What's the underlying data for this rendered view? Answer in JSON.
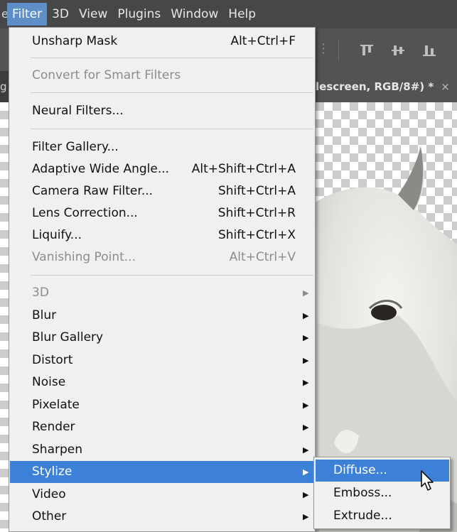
{
  "menubar": {
    "left_fragment": "e",
    "items": [
      {
        "label": "Filter",
        "active": true
      },
      {
        "label": "3D"
      },
      {
        "label": "View"
      },
      {
        "label": "Plugins"
      },
      {
        "label": "Window"
      },
      {
        "label": "Help"
      }
    ]
  },
  "tabbar": {
    "left_fragment": "g",
    "document_tab": "lescreen, RGB/8#) *",
    "close_symbol": "×"
  },
  "filter_menu": {
    "items": [
      {
        "label": "Unsharp Mask",
        "shortcut": "Alt+Ctrl+F"
      },
      {
        "label": "Convert for Smart Filters",
        "disabled": true
      },
      {
        "label": "Neural Filters..."
      },
      {
        "label": "Filter Gallery..."
      },
      {
        "label": "Adaptive Wide Angle...",
        "shortcut": "Alt+Shift+Ctrl+A"
      },
      {
        "label": "Camera Raw Filter...",
        "shortcut": "Shift+Ctrl+A"
      },
      {
        "label": "Lens Correction...",
        "shortcut": "Shift+Ctrl+R"
      },
      {
        "label": "Liquify...",
        "shortcut": "Shift+Ctrl+X"
      },
      {
        "label": "Vanishing Point...",
        "shortcut": "Alt+Ctrl+V",
        "disabled": true
      },
      {
        "label": "3D",
        "submenu": true,
        "disabled": true
      },
      {
        "label": "Blur",
        "submenu": true
      },
      {
        "label": "Blur Gallery",
        "submenu": true
      },
      {
        "label": "Distort",
        "submenu": true
      },
      {
        "label": "Noise",
        "submenu": true
      },
      {
        "label": "Pixelate",
        "submenu": true
      },
      {
        "label": "Render",
        "submenu": true
      },
      {
        "label": "Sharpen",
        "submenu": true
      },
      {
        "label": "Stylize",
        "submenu": true,
        "highlighted": true
      },
      {
        "label": "Video",
        "submenu": true
      },
      {
        "label": "Other",
        "submenu": true
      }
    ]
  },
  "stylize_submenu": {
    "items": [
      {
        "label": "Diffuse...",
        "highlighted": true
      },
      {
        "label": "Emboss..."
      },
      {
        "label": "Extrude..."
      }
    ]
  },
  "icons": {
    "submenu_arrow": "submenu-arrow-icon",
    "align_top": "align-top-icon",
    "align_vcenter": "align-vertical-center-icon",
    "align_bottom": "align-bottom-icon",
    "cursor": "mouse-pointer-icon"
  },
  "colors": {
    "highlight": "#3c80d8",
    "menubar_active": "#5d8ec6",
    "menu_bg": "#f0f0f0"
  }
}
